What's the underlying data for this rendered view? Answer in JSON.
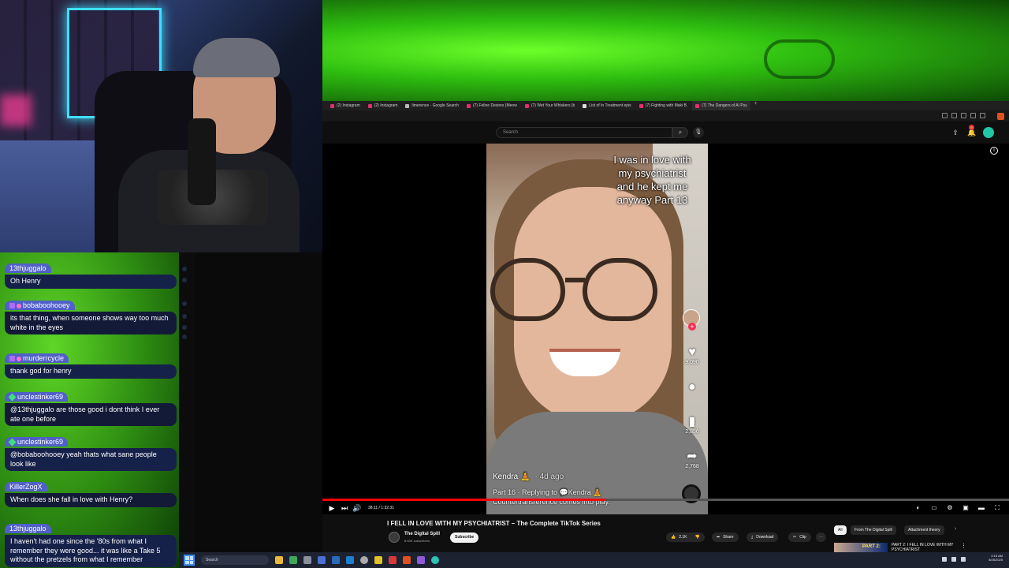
{
  "browser": {
    "tabs": [
      {
        "label": "(2) Instagram",
        "active": false
      },
      {
        "label": "(2) Instagram",
        "active": false
      },
      {
        "label": "limerence - Google Search",
        "active": false
      },
      {
        "label": "(7) Feline Desires (Meow",
        "active": false
      },
      {
        "label": "(7) Wet Your Whiskers (b",
        "active": false
      },
      {
        "label": "List of In Treatment epis",
        "active": false
      },
      {
        "label": "(7) Fighting with Maki B.",
        "active": false
      },
      {
        "label": "(7) The Dangers of AI Psy",
        "active": true
      }
    ],
    "new_tab": "+"
  },
  "youtube": {
    "search_placeholder": "Search",
    "notification_count": "9",
    "video_caption": "I was in love with my psychiatrist and he kept me anyway Part 13",
    "tiktok": {
      "likes": "9,090",
      "saves": "2,856",
      "shares": "2,768",
      "author": "Kendra 🧘",
      "posted": "· 4d ago",
      "reply_line": "Part 16 · Replying to 💬Kendra 🧘",
      "desc_line": "Countertransference comes into play."
    },
    "time": "38:11 / 1:32:31",
    "progress_fraction": 0.412,
    "title": "I FELL IN LOVE WITH MY PSYCHIATRIST – The Complete TikTok Series",
    "channel": "The Digital Spill",
    "subscribers": "8.63K subscribers",
    "subscribe_label": "Subscribe",
    "likes": "2.1K",
    "share_label": "Share",
    "download_label": "Download",
    "clip_label": "Clip",
    "chips": [
      "All",
      "From The Digital Spill",
      "Attachment theory"
    ],
    "rec_thumb_text": "PART 2:",
    "rec_title": "PART 2: I FELL IN LOVE WITH MY PSYCHIATRIST"
  },
  "taskbar": {
    "search_placeholder": "Search",
    "time": "2:15 AM",
    "date": "8/25/2025"
  },
  "chat": [
    {
      "user": "13thjuggalo",
      "text": "Oh Henry",
      "badge": "none"
    },
    {
      "user": "bobaboohooey",
      "text": "its that thing, when someone shows way too much white in the eyes",
      "badge": "sub"
    },
    {
      "user": "murderrcycle",
      "text": "thank god for henry",
      "badge": "sub"
    },
    {
      "user": "unclestinker69",
      "text": "@13thjuggalo are those good i dont think I ever ate one before",
      "badge": "mod"
    },
    {
      "user": "unclestinker69",
      "text": "@bobaboohooey yeah thats what sane people look like",
      "badge": "mod"
    },
    {
      "user": "KillerZogX",
      "text": "When does she fall in love with Henry?",
      "badge": "none"
    },
    {
      "user": "13thjuggalo",
      "text": "I haven't had one since the '80s from what I remember they were good... it was like a Take 5 without the pretzels from what I remember",
      "badge": "none"
    }
  ]
}
